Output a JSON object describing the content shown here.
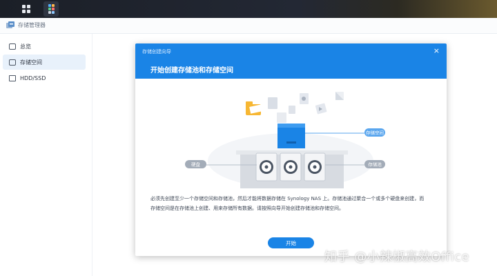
{
  "app": {
    "title": "存储管理器"
  },
  "sidebar": {
    "items": [
      {
        "label": "总览",
        "icon": "overview-icon",
        "active": false
      },
      {
        "label": "存储空间",
        "icon": "storage-icon",
        "active": true
      },
      {
        "label": "HDD/SSD",
        "icon": "disk-icon",
        "active": false
      }
    ]
  },
  "modal": {
    "window_title": "存储创建向导",
    "heading": "开始创建存储池和存储空间",
    "close_glyph": "×",
    "illustration": {
      "label_volume": "存储空间",
      "label_pool": "存储池",
      "label_disk": "硬盘"
    },
    "description_line1": "必须先创建至少一个存储空间和存储池，然后才能将数据存储在 Synology NAS 上。存储池通过聚合一个或多个硬盘来创建，而",
    "description_line2": "存储空间是在存储池上创建、用来存储所有数据。请按照向导开始创建存储池和存储空间。",
    "start_button": "开始"
  },
  "watermark": "知乎 @小辣椒高效Office",
  "colors": {
    "accent": "#1a84e6",
    "pill_gray": "#a3acb8"
  }
}
